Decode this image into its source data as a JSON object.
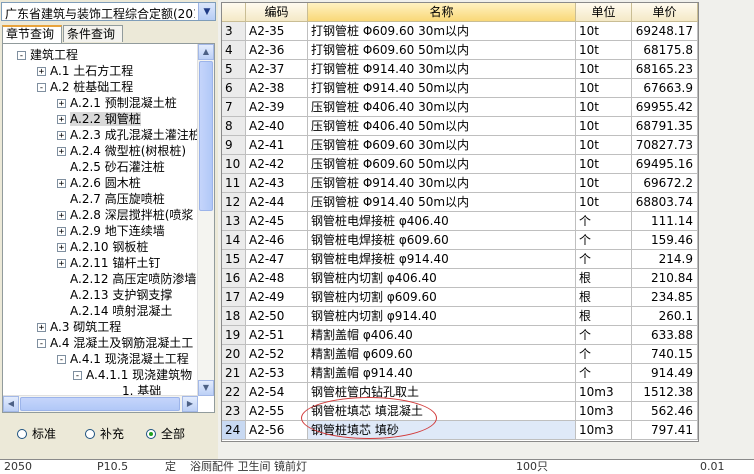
{
  "left_panel": {
    "dropdown_value": "广东省建筑与装饰工程综合定额(201",
    "tabs": [
      {
        "label": "章节查询",
        "active": true
      },
      {
        "label": "条件查询",
        "active": false
      }
    ],
    "tree": [
      {
        "label": "建筑工程",
        "level": 0,
        "toggle": "-"
      },
      {
        "label": "A.1 土石方工程",
        "level": 1,
        "toggle": "+"
      },
      {
        "label": "A.2 桩基础工程",
        "level": 1,
        "toggle": "-"
      },
      {
        "label": "A.2.1 预制混凝土桩",
        "level": 2,
        "toggle": "+"
      },
      {
        "label": "A.2.2 钢管桩",
        "level": 2,
        "toggle": "+",
        "selected": true
      },
      {
        "label": "A.2.3 成孔混凝土灌注桩",
        "level": 2,
        "toggle": "+"
      },
      {
        "label": "A.2.4 微型桩(树根桩)",
        "level": 2,
        "toggle": "+"
      },
      {
        "label": "A.2.5 砂石灌注桩",
        "level": 2,
        "toggle": ""
      },
      {
        "label": "A.2.6 圆木桩",
        "level": 2,
        "toggle": "+"
      },
      {
        "label": "A.2.7 高压旋喷桩",
        "level": 2,
        "toggle": ""
      },
      {
        "label": "A.2.8 深层搅拌桩(喷浆",
        "level": 2,
        "toggle": "+"
      },
      {
        "label": "A.2.9 地下连续墙",
        "level": 2,
        "toggle": "+"
      },
      {
        "label": "A.2.10 钢板桩",
        "level": 2,
        "toggle": "+"
      },
      {
        "label": "A.2.11 锚杆土钉",
        "level": 2,
        "toggle": "+"
      },
      {
        "label": "A.2.12 高压定喷防渗墙",
        "level": 2,
        "toggle": ""
      },
      {
        "label": "A.2.13 支护钢支撑",
        "level": 2,
        "toggle": ""
      },
      {
        "label": "A.2.14 喷射混凝土",
        "level": 2,
        "toggle": ""
      },
      {
        "label": "A.3 砌筑工程",
        "level": 1,
        "toggle": "+"
      },
      {
        "label": "A.4 混凝土及钢筋混凝土工",
        "level": 1,
        "toggle": "-"
      },
      {
        "label": "A.4.1 现浇混凝土工程",
        "level": 2,
        "toggle": "-"
      },
      {
        "label": "A.4.1.1 现浇建筑物",
        "level": 3,
        "toggle": "-"
      },
      {
        "label": "1. 基础",
        "level": 4,
        "toggle": ""
      }
    ],
    "radios": [
      {
        "label": "标准",
        "checked": false
      },
      {
        "label": "补充",
        "checked": false
      },
      {
        "label": "全部",
        "checked": true
      }
    ]
  },
  "grid": {
    "headers": {
      "rownum": "",
      "code": "编码",
      "name": "名称",
      "unit": "单位",
      "price": "单价"
    },
    "rows": [
      {
        "n": "3",
        "code": "A2-35",
        "name": "打钢管桩 Φ609.60 30m以内",
        "unit": "10t",
        "price": "69248.17"
      },
      {
        "n": "4",
        "code": "A2-36",
        "name": "打钢管桩 Φ609.60 50m以内",
        "unit": "10t",
        "price": "68175.8"
      },
      {
        "n": "5",
        "code": "A2-37",
        "name": "打钢管桩 Φ914.40 30m以内",
        "unit": "10t",
        "price": "68165.23"
      },
      {
        "n": "6",
        "code": "A2-38",
        "name": "打钢管桩 Φ914.40 50m以内",
        "unit": "10t",
        "price": "67663.9"
      },
      {
        "n": "7",
        "code": "A2-39",
        "name": "压钢管桩 Φ406.40 30m以内",
        "unit": "10t",
        "price": "69955.42"
      },
      {
        "n": "8",
        "code": "A2-40",
        "name": "压钢管桩 Φ406.40 50m以内",
        "unit": "10t",
        "price": "68791.35"
      },
      {
        "n": "9",
        "code": "A2-41",
        "name": "压钢管桩 Φ609.60 30m以内",
        "unit": "10t",
        "price": "70827.73"
      },
      {
        "n": "10",
        "code": "A2-42",
        "name": "压钢管桩 Φ609.60 50m以内",
        "unit": "10t",
        "price": "69495.16"
      },
      {
        "n": "11",
        "code": "A2-43",
        "name": "压钢管桩 Φ914.40 30m以内",
        "unit": "10t",
        "price": "69672.2"
      },
      {
        "n": "12",
        "code": "A2-44",
        "name": "压钢管桩 Φ914.40 50m以内",
        "unit": "10t",
        "price": "68803.74"
      },
      {
        "n": "13",
        "code": "A2-45",
        "name": "钢管桩电焊接桩 φ406.40",
        "unit": "个",
        "price": "111.14"
      },
      {
        "n": "14",
        "code": "A2-46",
        "name": "钢管桩电焊接桩 φ609.60",
        "unit": "个",
        "price": "159.46"
      },
      {
        "n": "15",
        "code": "A2-47",
        "name": "钢管桩电焊接桩 φ914.40",
        "unit": "个",
        "price": "214.9"
      },
      {
        "n": "16",
        "code": "A2-48",
        "name": "钢管桩内切割 φ406.40",
        "unit": "根",
        "price": "210.84"
      },
      {
        "n": "17",
        "code": "A2-49",
        "name": "钢管桩内切割 φ609.60",
        "unit": "根",
        "price": "234.85"
      },
      {
        "n": "18",
        "code": "A2-50",
        "name": "钢管桩内切割 φ914.40",
        "unit": "根",
        "price": "260.1"
      },
      {
        "n": "19",
        "code": "A2-51",
        "name": "精割盖帽 φ406.40",
        "unit": "个",
        "price": "633.88"
      },
      {
        "n": "20",
        "code": "A2-52",
        "name": "精割盖帽 φ609.60",
        "unit": "个",
        "price": "740.15"
      },
      {
        "n": "21",
        "code": "A2-53",
        "name": "精割盖帽 φ914.40",
        "unit": "个",
        "price": "914.49"
      },
      {
        "n": "22",
        "code": "A2-54",
        "name": "钢管桩管内钻孔取土",
        "unit": "10m3",
        "price": "1512.38"
      },
      {
        "n": "23",
        "code": "A2-55",
        "name": "钢管桩填芯 填混凝土",
        "unit": "10m3",
        "price": "562.46"
      },
      {
        "n": "24",
        "code": "A2-56",
        "name": "钢管桩填芯 填砂",
        "unit": "10m3",
        "price": "797.41",
        "current": true
      }
    ]
  },
  "bottom": {
    "items": [
      "2050",
      "P10.5",
      "定",
      "浴厕配件 卫生间 镜前灯",
      "100只",
      "0.01"
    ]
  },
  "colors": {
    "name_header": "#f9d878",
    "annotation": "#d23b3b",
    "selected_row": "#c8d9f2"
  }
}
